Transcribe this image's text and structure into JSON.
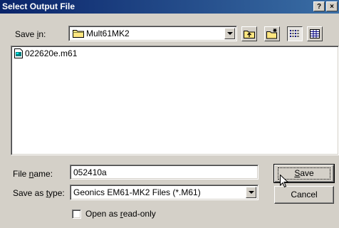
{
  "window": {
    "title": "Select Output File"
  },
  "title_buttons": {
    "help": "?",
    "close": "×"
  },
  "save_in": {
    "label_before": "Save ",
    "label_key": "i",
    "label_after": "n:",
    "value": "Mult61MK2"
  },
  "files": [
    {
      "name": "022620e.m61"
    }
  ],
  "file_name": {
    "label_before": "File ",
    "label_key": "n",
    "label_after": "ame:",
    "value": "052410a"
  },
  "save_type": {
    "label_before": "Save as ",
    "label_key": "t",
    "label_after": "ype:",
    "value": "Geonics EM61-MK2 Files (*.M61)"
  },
  "buttons": {
    "save_key": "S",
    "save_rest": "ave",
    "cancel": "Cancel"
  },
  "readonly": {
    "label_before": "Open as ",
    "label_key": "r",
    "label_after": "ead-only"
  },
  "icons": [
    "folder-icon",
    "up-folder-icon",
    "new-folder-icon",
    "list-view-icon",
    "details-view-icon",
    "file-icon",
    "mouse-cursor-icon"
  ]
}
